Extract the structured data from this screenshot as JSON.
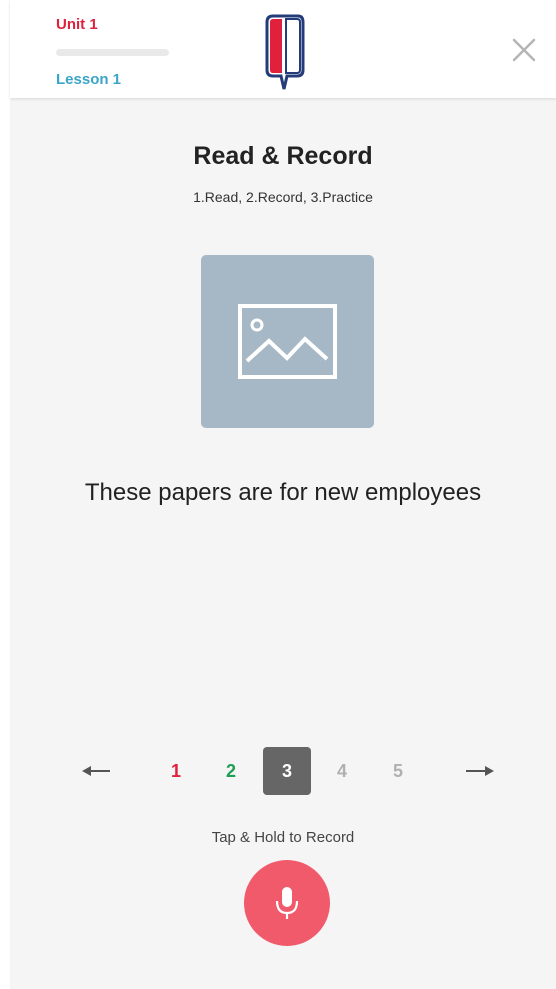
{
  "header": {
    "unit_label": "Unit 1",
    "lesson_label": "Lesson 1",
    "lesson_progress": 0,
    "close_icon": "close-icon",
    "logo_icon": "speech-bubble-logo"
  },
  "exercise": {
    "title": "Read & Record",
    "steps": "1.Read, 2.Record, 3.Practice",
    "image_icon": "image-placeholder-icon",
    "sentence": "These papers are for new employees"
  },
  "pager": {
    "prev_icon": "arrow-left-icon",
    "next_icon": "arrow-right-icon",
    "current": 3,
    "pages": [
      {
        "label": "1",
        "status": "failed"
      },
      {
        "label": "2",
        "status": "passed"
      },
      {
        "label": "3",
        "status": "current"
      },
      {
        "label": "4",
        "status": "pending"
      },
      {
        "label": "5",
        "status": "pending"
      }
    ]
  },
  "recorder": {
    "hint": "Tap & Hold to Record",
    "mic_icon": "microphone-icon"
  },
  "colors": {
    "unit": "#e0213c",
    "lesson": "#3aa5c6",
    "failed": "#e0213c",
    "passed": "#1e9e55",
    "current_bg": "#666666",
    "current_text": "#ffffff",
    "pending": "#b0b0b0",
    "mic_button": "#f05a6a",
    "image_bg": "#a6b7c6",
    "background": "#f5f5f5"
  }
}
